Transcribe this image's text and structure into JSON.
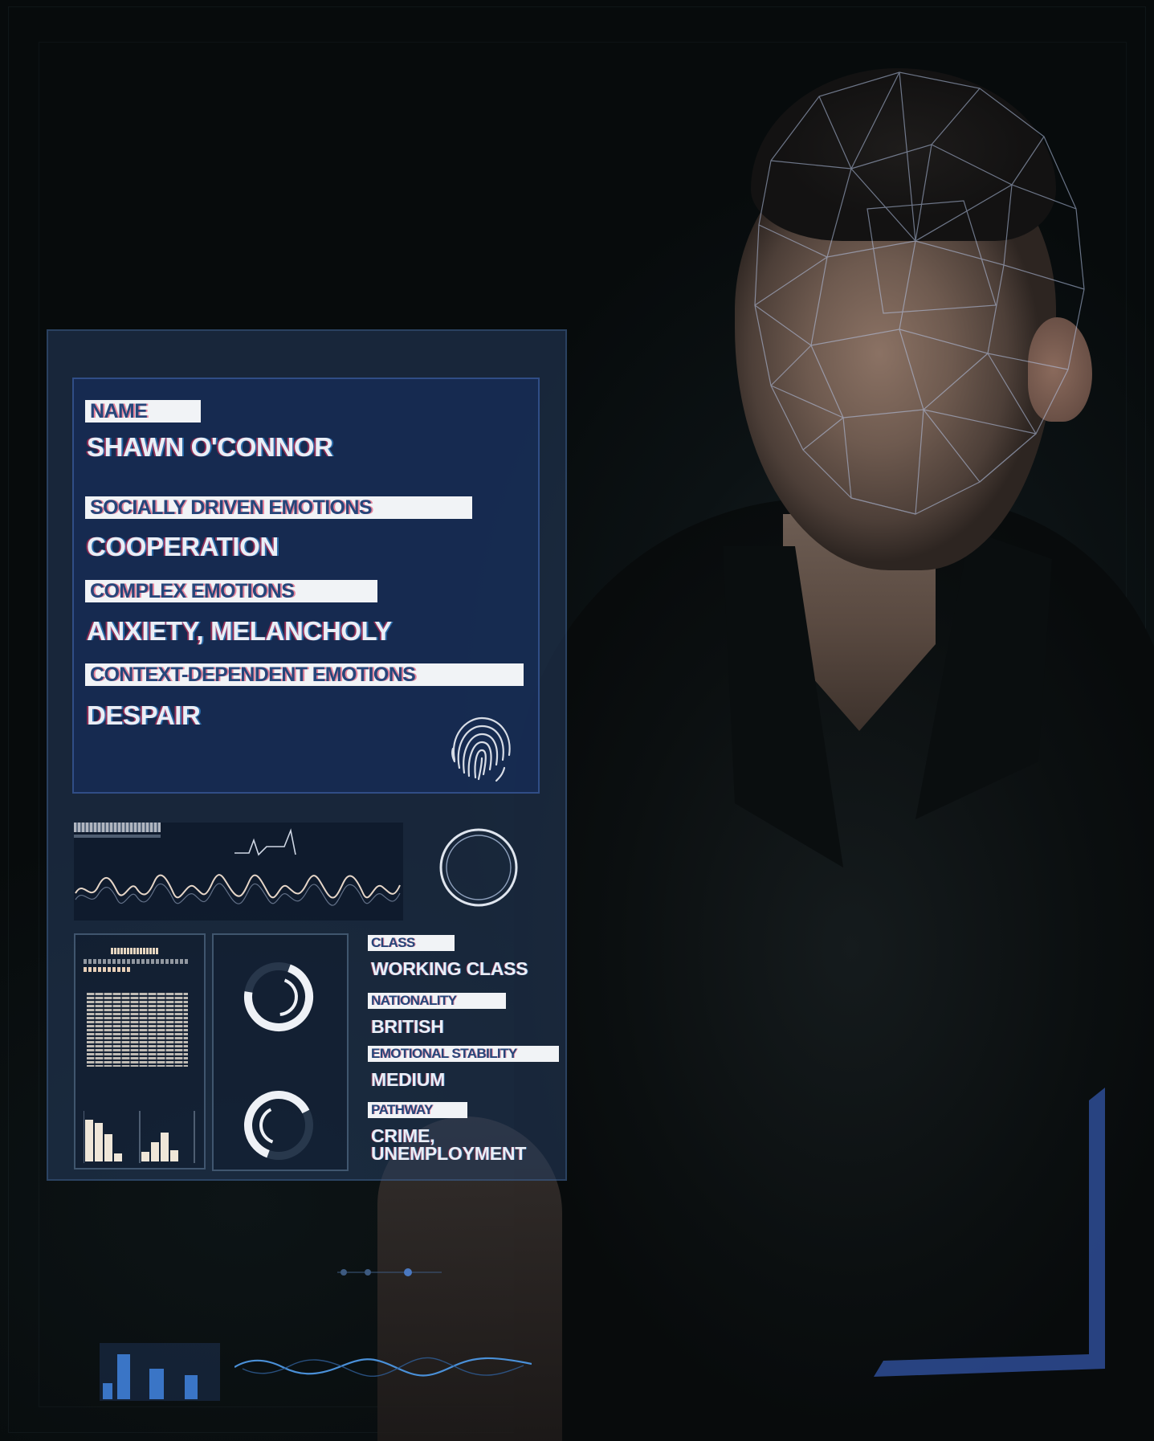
{
  "profile": {
    "name_label": "NAME",
    "name_value": "SHAWN O'CONNOR",
    "socially_label": "SOCIALLY DRIVEN EMOTIONS",
    "socially_value": "COOPERATION",
    "complex_label": "COMPLEX EMOTIONS",
    "complex_value": "ANXIETY, MELANCHOLY",
    "context_label": "CONTEXT-DEPENDENT EMOTIONS",
    "context_value": "DESPAIR"
  },
  "stats": {
    "class_label": "CLASS",
    "class_value": "WORKING CLASS",
    "nationality_label": "NATIONALITY",
    "nationality_value": "BRITISH",
    "stability_label": "EMOTIONAL STABILITY",
    "stability_value": "MEDIUM",
    "pathway_label": "PATHWAY",
    "pathway_value_line1": "CRIME,",
    "pathway_value_line2": "UNEMPLOYMENT"
  },
  "icons": {
    "fingerprint": "fingerprint-icon",
    "ring": "ring-indicator-icon",
    "gauge_top": "progress-gauge-icon",
    "gauge_bottom": "progress-gauge-icon"
  },
  "gauges": {
    "top_fraction": 0.72,
    "bottom_fraction": 0.62
  },
  "colors": {
    "panel": "#26406a",
    "tag_bg": "#f1f3f6",
    "tag_text": "#26467a",
    "value_text": "#e9eef6",
    "hud_line": "#8fb3e6"
  }
}
